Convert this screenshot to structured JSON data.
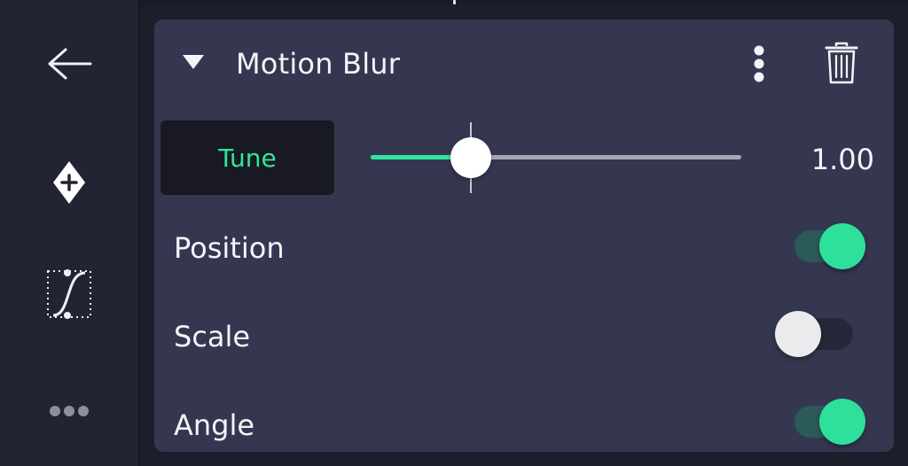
{
  "panel": {
    "title": "Motion Blur",
    "tune_label": "Tune",
    "slider": {
      "value_label": "1.00",
      "level": 0.27,
      "default_level": 0.27
    },
    "rows": [
      {
        "label": "Position",
        "enabled": true
      },
      {
        "label": "Scale",
        "enabled": false
      },
      {
        "label": "Angle",
        "enabled": true
      }
    ]
  },
  "sidebar": {
    "items": [
      {
        "icon": "back-arrow-icon"
      },
      {
        "icon": "add-keyframe-icon"
      },
      {
        "icon": "easing-curve-icon"
      },
      {
        "icon": "more-horizontal-icon"
      }
    ]
  },
  "colors": {
    "accent": "#2ee6a0",
    "panel": "#353750",
    "sidebar": "#222433",
    "tune_bg": "#181922"
  }
}
